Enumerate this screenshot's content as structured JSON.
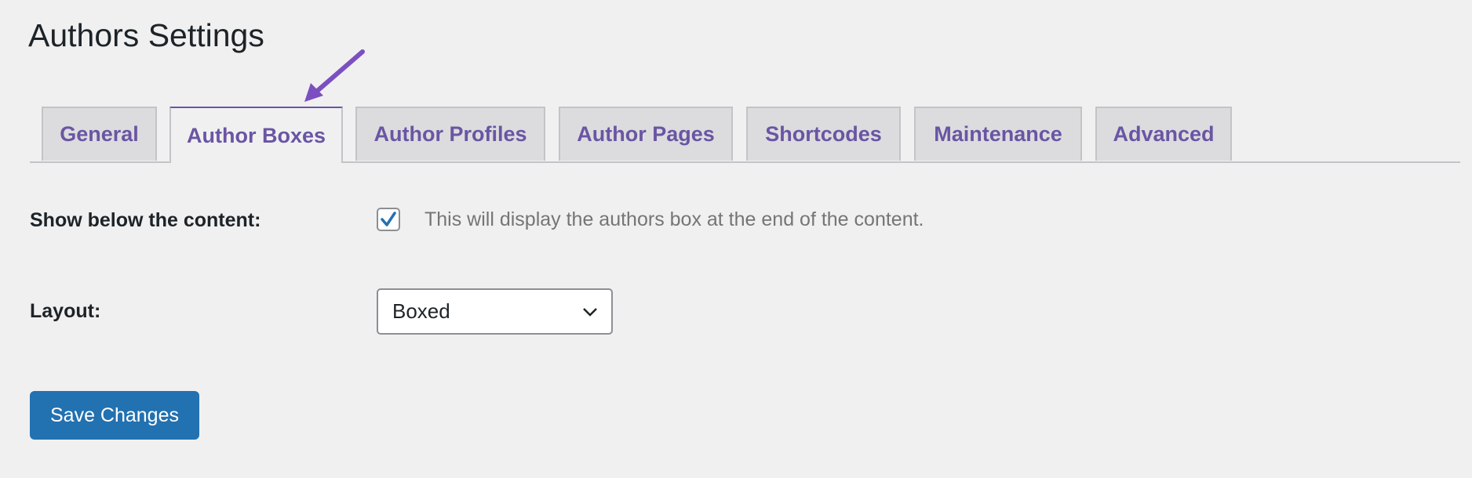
{
  "page": {
    "title": "Authors Settings"
  },
  "tabs": [
    {
      "label": "General",
      "active": false
    },
    {
      "label": "Author Boxes",
      "active": true
    },
    {
      "label": "Author Profiles",
      "active": false
    },
    {
      "label": "Author Pages",
      "active": false
    },
    {
      "label": "Shortcodes",
      "active": false
    },
    {
      "label": "Maintenance",
      "active": false
    },
    {
      "label": "Advanced",
      "active": false
    }
  ],
  "settings": {
    "show_below": {
      "label": "Show below the content:",
      "checked": true,
      "description": "This will display the authors box at the end of the content."
    },
    "layout": {
      "label": "Layout:",
      "value": "Boxed"
    }
  },
  "actions": {
    "save_label": "Save Changes"
  },
  "colors": {
    "accent": "#6a55a3",
    "button": "#2271b1",
    "annotation_arrow": "#7b4fc0"
  }
}
